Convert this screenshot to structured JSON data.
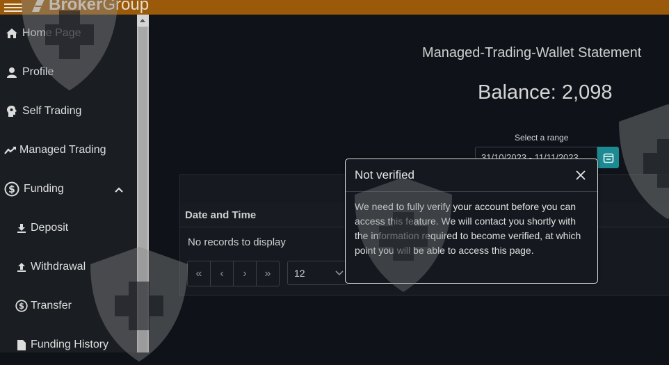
{
  "brand": {
    "name_bold": "Broker",
    "name_light": "Group"
  },
  "sidebar": {
    "items": [
      {
        "label": "Home Page",
        "icon": "home-icon"
      },
      {
        "label": "Profile",
        "icon": "user-icon"
      },
      {
        "label": "Self Trading",
        "icon": "brain-icon"
      },
      {
        "label": "Managed Trading",
        "icon": "trend-icon"
      },
      {
        "label": "Funding",
        "icon": "dollar-icon",
        "expanded": true
      },
      {
        "label": "Deposit",
        "icon": "download-icon"
      },
      {
        "label": "Withdrawal",
        "icon": "upload-icon"
      },
      {
        "label": "Transfer",
        "icon": "dollar-icon"
      },
      {
        "label": "Funding History",
        "icon": "file-icon"
      }
    ]
  },
  "main": {
    "title": "Managed-Trading-Wallet Statement",
    "balance": "Balance: 2,098",
    "range_label": "Select a range",
    "range_value": "31/10/2023 - 11/11/2023"
  },
  "grid": {
    "columns": [
      "Date and Time"
    ],
    "empty_text": "No records to display",
    "pager": [
      "«",
      "‹",
      "›",
      "»"
    ],
    "page_size": "12"
  },
  "modal": {
    "title": "Not verified",
    "body": "We need to fully verify your account before you can access this feature. We will contact you shortly with the information required to become verified, at which point you will be able to access this page."
  },
  "colors": {
    "topbar": "#9a5a0a",
    "accent": "#1c8a92",
    "background": "#0f1319"
  }
}
